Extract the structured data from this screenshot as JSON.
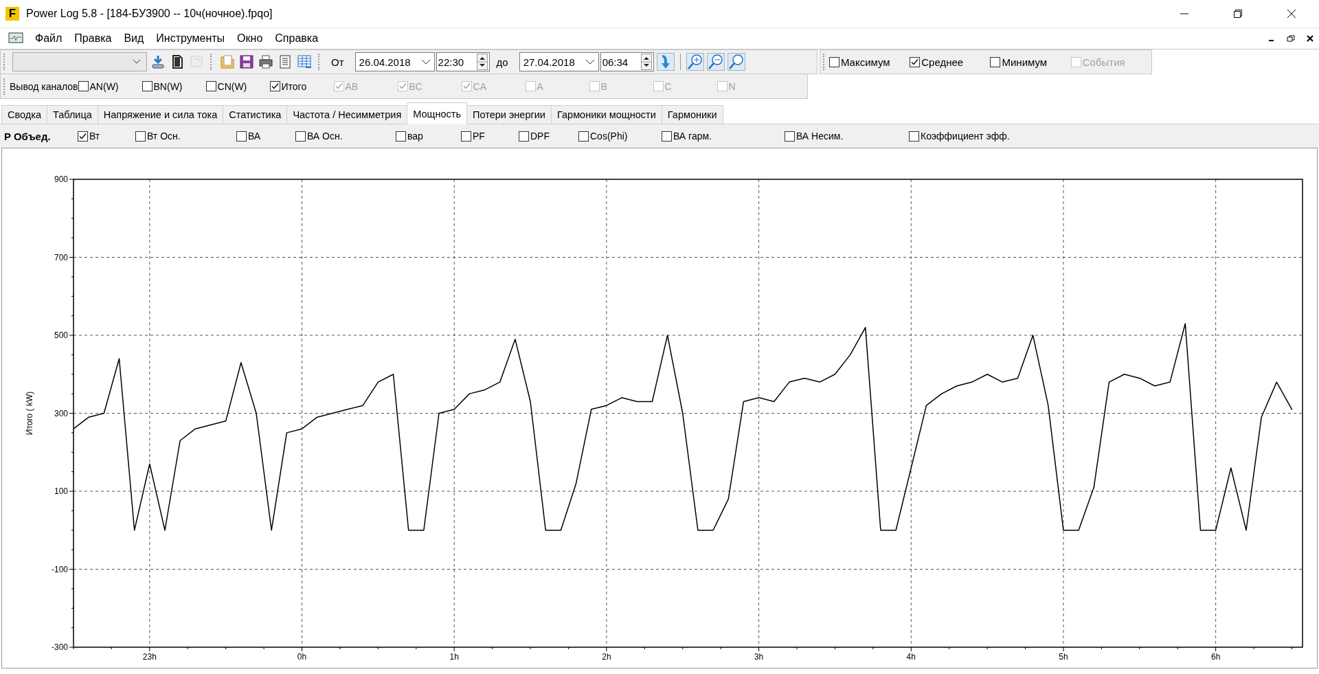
{
  "window": {
    "logo": "F",
    "title": "Power Log 5.8 - [184-БУ3900 -- 10ч(ночное).fpqo]"
  },
  "menu": [
    "Файл",
    "Правка",
    "Вид",
    "Инструменты",
    "Окно",
    "Справка"
  ],
  "toolbar": {
    "from_label": "От",
    "from_date": "26.04.2018",
    "from_time": "22:30",
    "to_label": "до",
    "to_date": "27.04.2018",
    "to_time": "06:34",
    "options": [
      {
        "label": "Максимум",
        "checked": false,
        "disabled": false
      },
      {
        "label": "Среднее",
        "checked": true,
        "disabled": false
      },
      {
        "label": "Минимум",
        "checked": false,
        "disabled": false
      },
      {
        "label": "События",
        "checked": false,
        "disabled": true
      }
    ]
  },
  "channels": {
    "label": "Вывод каналов",
    "items": [
      {
        "label": "AN(W)",
        "checked": false,
        "disabled": false
      },
      {
        "label": "BN(W)",
        "checked": false,
        "disabled": false
      },
      {
        "label": "CN(W)",
        "checked": false,
        "disabled": false
      },
      {
        "label": "Итого",
        "checked": true,
        "disabled": false
      },
      {
        "label": "AB",
        "checked": true,
        "disabled": true
      },
      {
        "label": "BC",
        "checked": true,
        "disabled": true
      },
      {
        "label": "CA",
        "checked": true,
        "disabled": true
      },
      {
        "label": "A",
        "checked": false,
        "disabled": true
      },
      {
        "label": "B",
        "checked": false,
        "disabled": true
      },
      {
        "label": "C",
        "checked": false,
        "disabled": true
      },
      {
        "label": "N",
        "checked": false,
        "disabled": true
      }
    ]
  },
  "tabs": [
    {
      "label": "Сводка",
      "selected": false
    },
    {
      "label": "Таблица",
      "selected": false
    },
    {
      "label": "Напряжение и сила тока",
      "selected": false
    },
    {
      "label": "Статистика",
      "selected": false
    },
    {
      "label": "Частота / Несимметрия",
      "selected": false
    },
    {
      "label": "Мощность",
      "selected": true
    },
    {
      "label": "Потери энергии",
      "selected": false
    },
    {
      "label": "Гармоники мощности",
      "selected": false
    },
    {
      "label": "Гармоники",
      "selected": false
    }
  ],
  "power": {
    "label": "P Объед.",
    "items": [
      {
        "label": "Вт",
        "checked": true
      },
      {
        "label": "Вт Осн.",
        "checked": false
      },
      {
        "label": "ВА",
        "checked": false
      },
      {
        "label": "ВА Осн.",
        "checked": false
      },
      {
        "label": "вар",
        "checked": false
      },
      {
        "label": "PF",
        "checked": false
      },
      {
        "label": "DPF",
        "checked": false
      },
      {
        "label": "Cos(Phi)",
        "checked": false
      },
      {
        "label": "ВА гарм.",
        "checked": false
      },
      {
        "label": "ВА Несим.",
        "checked": false
      },
      {
        "label": "Коэффициент эфф.",
        "checked": false
      }
    ]
  },
  "chart": {
    "chart_data": {
      "type": "line",
      "ylabel": "Итого ( kW)",
      "grid": true,
      "categories": [
        null,
        null,
        null,
        null,
        null,
        "23h",
        null,
        null,
        null,
        null,
        null,
        null,
        null,
        null,
        null,
        "0h",
        null,
        null,
        null,
        null,
        null,
        null,
        null,
        null,
        null,
        "1h",
        null,
        null,
        null,
        null,
        null,
        null,
        null,
        null,
        null,
        "2h",
        null,
        null,
        null,
        null,
        null,
        null,
        null,
        null,
        null,
        "3h",
        null,
        null,
        null,
        null,
        null,
        null,
        null,
        null,
        null,
        "4h",
        null,
        null,
        null,
        null,
        null,
        null,
        null,
        null,
        null,
        "5h",
        null,
        null,
        null,
        null,
        null,
        null,
        null,
        null,
        null,
        "6h",
        null,
        null,
        null,
        null,
        null
      ],
      "series": [
        {
          "color": "#000000",
          "values": [
            260,
            290,
            300,
            440,
            0,
            170,
            0,
            230,
            260,
            270,
            280,
            430,
            300,
            0,
            250,
            260,
            290,
            300,
            310,
            320,
            380,
            400,
            0,
            0,
            300,
            310,
            350,
            360,
            380,
            490,
            330,
            0,
            0,
            120,
            310,
            320,
            340,
            330,
            330,
            500,
            300,
            0,
            0,
            80,
            330,
            340,
            330,
            380,
            390,
            380,
            400,
            450,
            520,
            0,
            0,
            160,
            320,
            350,
            370,
            380,
            400,
            380,
            390,
            500,
            320,
            0,
            0,
            110,
            380,
            400,
            390,
            370,
            380,
            530,
            0,
            0,
            160,
            0,
            290,
            380,
            310
          ]
        }
      ],
      "ylim": [
        -300,
        900
      ],
      "yticks": [
        -300,
        -100,
        100,
        300,
        500,
        700,
        900
      ]
    }
  }
}
